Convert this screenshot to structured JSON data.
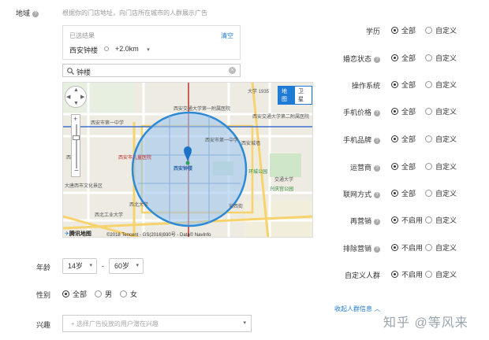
{
  "region": {
    "label": "地域",
    "hint": "根据你的门店地址，向门店所在城市的人群展示广告"
  },
  "selected": {
    "title": "已选结果",
    "clear": "清空",
    "tag": "西安钟楼",
    "radius": "+2.0km"
  },
  "search": {
    "value": "钟楼"
  },
  "map": {
    "mode_map": "地图",
    "mode_sat": "卫星",
    "logo": "腾讯地图",
    "copyright": "©2018 Tencent - GS(2016)930号 - Data© NavInfo",
    "pois": [
      "大学 1935",
      "西安交通大学第一附属医院",
      "西安交通大学第二附属医院",
      "西安市第一中学",
      "西安市儿童医院",
      "西稍门",
      "西安城墙",
      "西安钟楼",
      "西安市第一中学",
      "环城公园",
      "大唐西市文化景区",
      "西北工业大学",
      "西北大学",
      "兴庆宫公园",
      "交通大学",
      "安西街",
      "西安交通大学",
      "西安交通大学",
      "西安交通大学",
      "雁塔"
    ]
  },
  "age": {
    "label": "年龄",
    "from": "14岁",
    "to": "60岁",
    "dash": "-"
  },
  "gender": {
    "label": "性别",
    "options": [
      "全部",
      "男",
      "女"
    ],
    "selected": 0
  },
  "interest": {
    "label": "兴趣",
    "placeholder": "+ 选择广告投放的用户潜在兴趣"
  },
  "right": {
    "rows": [
      {
        "label": "学历",
        "help": false,
        "options": [
          "全部",
          "自定义"
        ],
        "sel": 0
      },
      {
        "label": "婚恋状态",
        "help": true,
        "options": [
          "全部",
          "自定义"
        ],
        "sel": 0
      },
      {
        "label": "操作系统",
        "help": false,
        "options": [
          "全部",
          "自定义"
        ],
        "sel": 0
      },
      {
        "label": "手机价格",
        "help": true,
        "options": [
          "全部",
          "自定义"
        ],
        "sel": 0
      },
      {
        "label": "手机品牌",
        "help": true,
        "options": [
          "全部",
          "自定义"
        ],
        "sel": 0
      },
      {
        "label": "运营商",
        "help": true,
        "options": [
          "全部",
          "自定义"
        ],
        "sel": 0
      },
      {
        "label": "联网方式",
        "help": true,
        "options": [
          "全部",
          "自定义"
        ],
        "sel": 0
      },
      {
        "label": "再营销",
        "help": true,
        "options": [
          "不启用",
          "自定义"
        ],
        "sel": 0
      },
      {
        "label": "排除营销",
        "help": true,
        "options": [
          "不启用",
          "自定义"
        ],
        "sel": 0
      },
      {
        "label": "自定义人群",
        "help": false,
        "options": [
          "不启用",
          "自定义"
        ],
        "sel": 0
      }
    ],
    "collapse": "收起人群信息"
  },
  "watermark": "知乎 @等风来",
  "colors": {
    "accent": "#1f7bd6",
    "circle": "#2d8ad6",
    "pin": "#1b73c9",
    "redline": "#c0302b"
  }
}
